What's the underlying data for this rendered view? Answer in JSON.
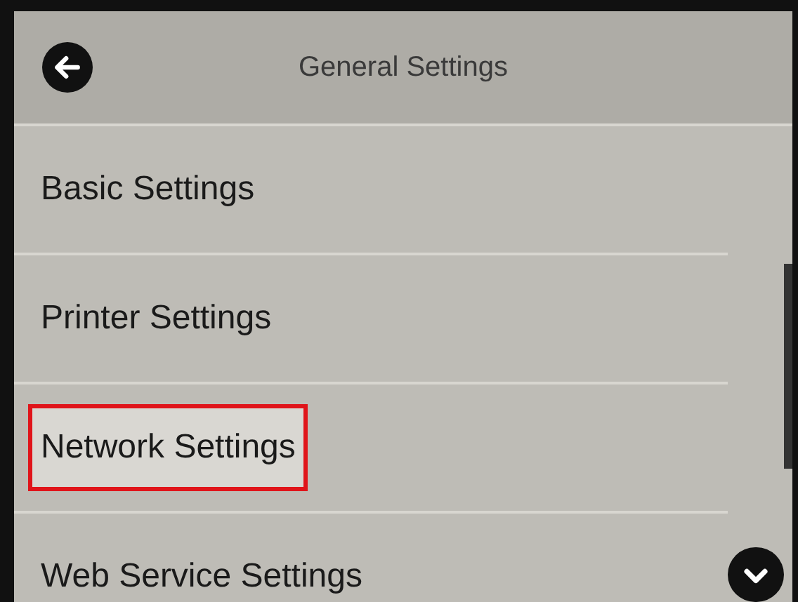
{
  "header": {
    "title": "General Settings"
  },
  "items": [
    {
      "label": "Basic Settings",
      "highlighted": false
    },
    {
      "label": "Printer Settings",
      "highlighted": false
    },
    {
      "label": "Network Settings",
      "highlighted": true
    },
    {
      "label": "Web Service Settings",
      "highlighted": false
    }
  ]
}
